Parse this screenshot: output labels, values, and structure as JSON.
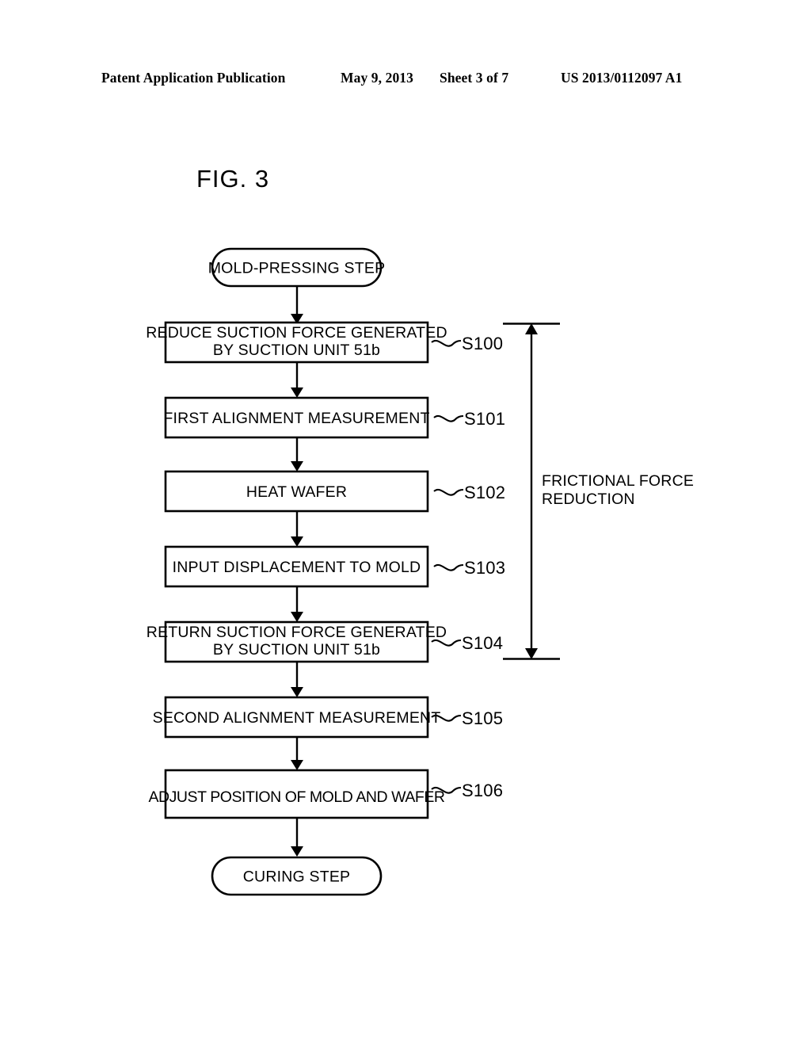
{
  "header": {
    "publication": "Patent Application Publication",
    "date": "May 9, 2013",
    "sheet": "Sheet 3 of 7",
    "patent_number": "US 2013/0112097 A1"
  },
  "figure": {
    "title": "FIG. 3",
    "type": "flowchart"
  },
  "flowchart": {
    "start_terminator": {
      "label": "MOLD-PRESSING STEP"
    },
    "end_terminator": {
      "label": "CURING STEP"
    },
    "steps": [
      {
        "code": "S100",
        "lines": [
          "REDUCE SUCTION FORCE GENERATED",
          "BY SUCTION UNIT 51b"
        ]
      },
      {
        "code": "S101",
        "lines": [
          "FIRST ALIGNMENT MEASUREMENT"
        ]
      },
      {
        "code": "S102",
        "lines": [
          "HEAT WAFER"
        ]
      },
      {
        "code": "S103",
        "lines": [
          "INPUT DISPLACEMENT TO MOLD"
        ]
      },
      {
        "code": "S104",
        "lines": [
          "RETURN SUCTION FORCE GENERATED",
          "BY SUCTION UNIT 51b"
        ]
      },
      {
        "code": "S105",
        "lines": [
          "SECOND ALIGNMENT MEASUREMENT"
        ]
      },
      {
        "code": "S106",
        "lines": [
          "ADJUST POSITION OF MOLD AND WAFER"
        ]
      }
    ],
    "annotation": {
      "lines": [
        "FRICTIONAL FORCE",
        "REDUCTION"
      ],
      "spans_from": "S100",
      "spans_to": "S104"
    }
  },
  "colors": {
    "ink": "#000000",
    "paper": "#ffffff"
  }
}
